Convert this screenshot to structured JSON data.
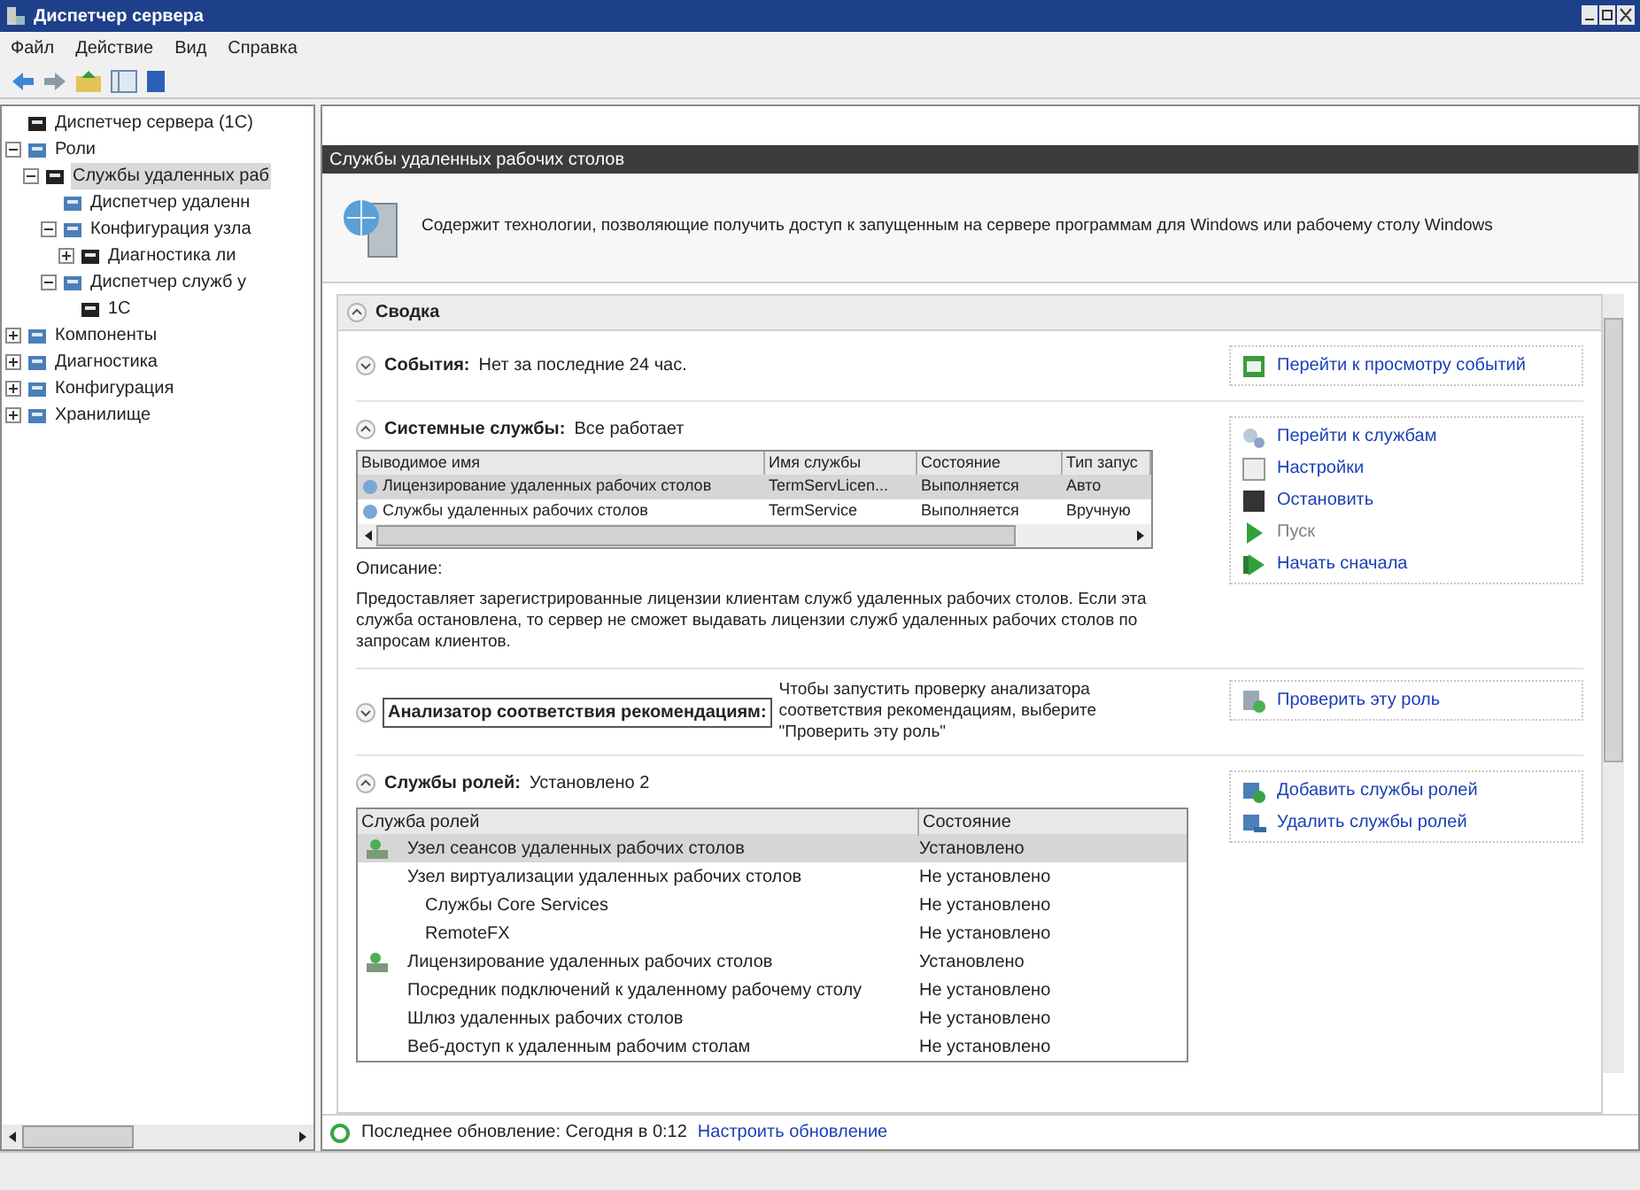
{
  "window": {
    "title": "Диспетчер сервера"
  },
  "menu": [
    "Файл",
    "Действие",
    "Вид",
    "Справка"
  ],
  "tree": [
    {
      "label": "Диспетчер сервера (1C)",
      "selected": false,
      "children": [
        {
          "label": "Роли",
          "expanded": true,
          "selected": false,
          "children": [
            {
              "label": "Службы удаленных раб",
              "expanded": true,
              "selected": true,
              "children": [
                {
                  "label": "Диспетчер удаленн",
                  "selected": false
                },
                {
                  "label": "Конфигурация узла",
                  "expanded": true,
                  "selected": false,
                  "children": [
                    {
                      "label": "Диагностика ли",
                      "expanded": false,
                      "selected": false
                    }
                  ]
                },
                {
                  "label": "Диспетчер служб у",
                  "expanded": true,
                  "selected": false,
                  "children": [
                    {
                      "label": "1C",
                      "selected": false
                    }
                  ]
                }
              ]
            }
          ]
        },
        {
          "label": "Компоненты",
          "expanded": false,
          "selected": false
        },
        {
          "label": "Диагностика",
          "expanded": false,
          "selected": false
        },
        {
          "label": "Конфигурация",
          "expanded": false,
          "selected": false
        },
        {
          "label": "Хранилище",
          "expanded": false,
          "selected": false
        }
      ]
    }
  ],
  "header": {
    "title": "Службы удаленных рабочих столов",
    "description": "Содержит технологии, позволяющие получить доступ к запущенным на сервере программам для Windows или рабочему столу Windows"
  },
  "summary": {
    "title": "Сводка",
    "expanded": true,
    "events": {
      "label": "События:",
      "value": "Нет за последние 24 час.",
      "expanded": false,
      "links": [
        {
          "label": "Перейти к просмотру событий",
          "disabled": false
        }
      ]
    },
    "services": {
      "label": "Системные службы:",
      "value": "Все работает",
      "expanded": true,
      "columns": [
        "Выводимое имя",
        "Имя службы",
        "Состояние",
        "Тип запус"
      ],
      "rows": [
        {
          "cells": [
            "Лицензирование удаленных рабочих столов",
            "TermServLicen...",
            "Выполняется",
            "Авто"
          ],
          "selected": true
        },
        {
          "cells": [
            "Службы удаленных рабочих столов",
            "TermService",
            "Выполняется",
            "Вручную"
          ],
          "selected": false
        }
      ],
      "description_label": "Описание:",
      "description": "Предоставляет зарегистрированные лицензии клиентам служб удаленных рабочих столов. Если эта служба остановлена, то сервер не сможет выдавать лицензии служб удаленных рабочих столов по запросам клиентов.",
      "links": [
        {
          "label": "Перейти к службам",
          "disabled": false,
          "kind": "services"
        },
        {
          "label": "Настройки",
          "disabled": false,
          "kind": "settings"
        },
        {
          "label": "Остановить",
          "disabled": false,
          "kind": "stop"
        },
        {
          "label": "Пуск",
          "disabled": true,
          "kind": "start"
        },
        {
          "label": "Начать сначала",
          "disabled": false,
          "kind": "restart"
        }
      ]
    },
    "bpa": {
      "label": "Анализатор соответствия рекомендациям:",
      "value": "Чтобы запустить проверку анализатора соответствия рекомендациям, выберите \"Проверить эту роль\"",
      "expanded": false,
      "links": [
        {
          "label": "Проверить эту роль",
          "disabled": false,
          "kind": "check"
        }
      ]
    },
    "role_services": {
      "label": "Службы ролей:",
      "value": "Установлено 2",
      "expanded": true,
      "columns": [
        "Служба ролей",
        "Состояние"
      ],
      "rows": [
        {
          "name": "Узел сеансов удаленных рабочих столов",
          "state": "Установлено",
          "installed": true,
          "selected": true
        },
        {
          "name": "Узел виртуализации удаленных рабочих столов",
          "state": "Не установлено",
          "installed": false,
          "selected": false,
          "children": [
            {
              "name": "Службы Core Services",
              "state": "Не установлено",
              "installed": false,
              "selected": false
            },
            {
              "name": "RemoteFX",
              "state": "Не установлено",
              "installed": false,
              "selected": false
            }
          ]
        },
        {
          "name": "Лицензирование удаленных рабочих столов",
          "state": "Установлено",
          "installed": true,
          "selected": false
        },
        {
          "name": "Посредник подключений к удаленному рабочему столу",
          "state": "Не установлено",
          "installed": false,
          "selected": false
        },
        {
          "name": "Шлюз удаленных рабочих столов",
          "state": "Не установлено",
          "installed": false,
          "selected": false
        },
        {
          "name": "Веб-доступ к удаленным рабочим столам",
          "state": "Не установлено",
          "installed": false,
          "selected": false
        }
      ],
      "links": [
        {
          "label": "Добавить службы ролей",
          "disabled": false,
          "kind": "add"
        },
        {
          "label": "Удалить службы ролей",
          "disabled": false,
          "kind": "remove"
        }
      ]
    }
  },
  "footer": {
    "text": "Последнее обновление: Сегодня в 0:12",
    "link": "Настроить обновление"
  }
}
